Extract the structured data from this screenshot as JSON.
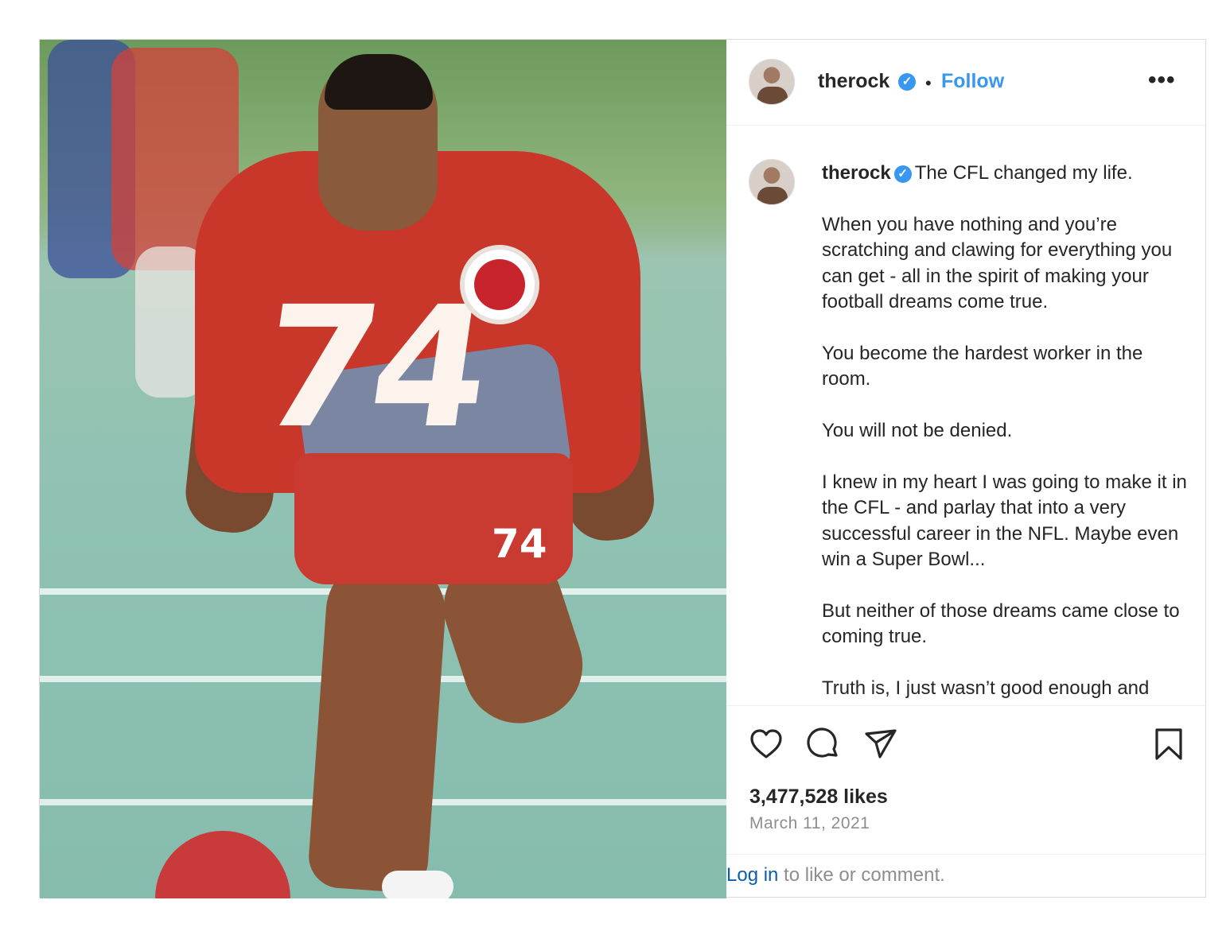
{
  "post": {
    "author": {
      "username": "therock",
      "verified_icon": "verified-badge-icon",
      "follow_label": "Follow",
      "separator": "•",
      "more_label": "•••"
    },
    "photo": {
      "jersey_number": "74",
      "shorts_number": "74"
    },
    "caption": {
      "username": "therock",
      "first_line": "The CFL changed my life.",
      "paragraphs": [
        "When you have nothing and you’re scratching and clawing for everything you can get - all in the spirit of making your football dreams come true.",
        "You become the hardest worker in the room.",
        "You will not be denied.",
        "I knew in my heart I was going to make it in the CFL - and parlay that into a very successful career in the NFL. Maybe even win a Super Bowl...",
        "But neither of those dreams came close to coming true.",
        "Truth is, I just wasn’t good enough and"
      ]
    },
    "actions": {
      "like_icon": "heart-icon",
      "comment_icon": "comment-icon",
      "share_icon": "send-icon",
      "save_icon": "bookmark-icon"
    },
    "likes_text": "3,477,528 likes",
    "date_text": "March 11, 2021",
    "login": {
      "link_label": "Log in",
      "rest_text": " to like or comment."
    },
    "colors": {
      "link_blue": "#3897f0",
      "verified_blue": "#3897f0",
      "muted_gray": "#8e8e8e",
      "jersey_red": "#c9362a"
    }
  }
}
